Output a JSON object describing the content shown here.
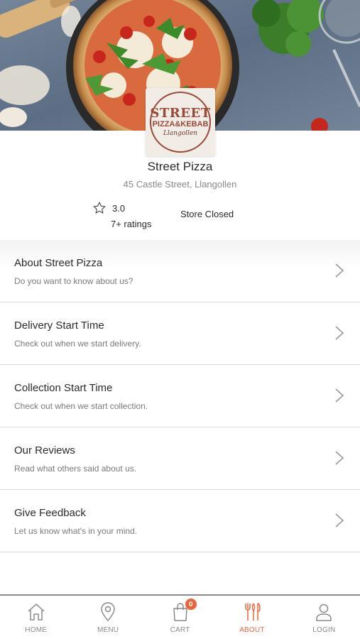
{
  "store": {
    "logo": {
      "line1": "STREET",
      "line2": "PIZZA&KEBAB",
      "line3": "Llangollen"
    },
    "name": "Street Pizza",
    "address": "45 Castle Street, Llangollen",
    "rating": "3.0",
    "rating_count": "7+ ratings",
    "status": "Store Closed"
  },
  "menu_items": [
    {
      "title": "About Street Pizza",
      "subtitle": "Do you want to know about us?"
    },
    {
      "title": "Delivery Start Time",
      "subtitle": "Check out when we start delivery."
    },
    {
      "title": "Collection Start Time",
      "subtitle": "Check out when we start collection."
    },
    {
      "title": "Our Reviews",
      "subtitle": "Read what others said about us."
    },
    {
      "title": "Give Feedback",
      "subtitle": "Let us know what's in your mind."
    }
  ],
  "nav": {
    "home": "HOME",
    "menu": "MENU",
    "cart": "CART",
    "cart_count": "0",
    "about": "ABOUT",
    "login": "LOGIN"
  },
  "colors": {
    "accent": "#e8663c",
    "muted": "#8a8a8a",
    "logo": "#9a4a3a"
  },
  "icons": [
    "star-icon",
    "chevron-right-icon",
    "home-icon",
    "location-pin-icon",
    "shopping-bag-icon",
    "cutlery-icon",
    "user-icon"
  ]
}
